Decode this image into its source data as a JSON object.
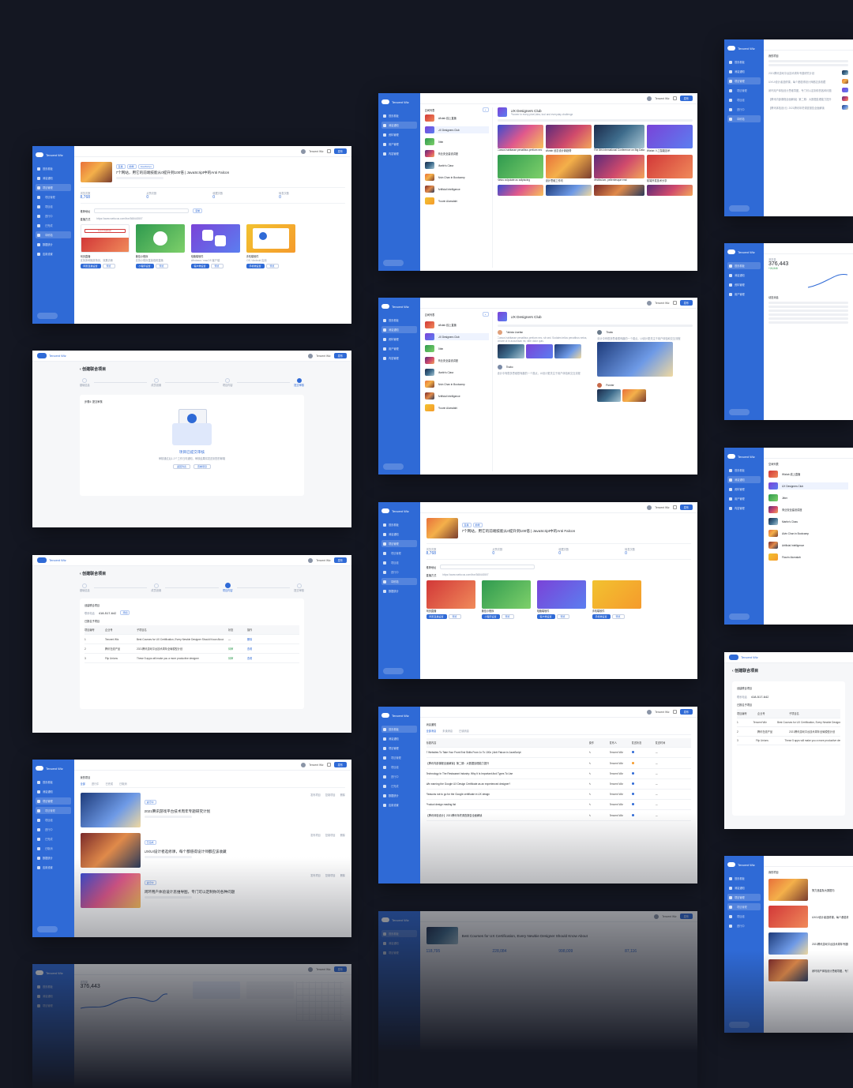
{
  "brand": {
    "name": "Tencent Wiz",
    "user": "Tencent Wiz",
    "publish": "发布"
  },
  "nav": [
    "首页看板",
    "消息通知",
    "资料管理",
    "项目管理",
    "用户管理",
    "数据统计",
    "内容管理",
    "应用设置"
  ],
  "nav_sub": [
    "项目管理",
    "项目组",
    "进行中",
    "已完成",
    "已取消",
    "草稿箱"
  ],
  "s1": {
    "title": "7个网站，用它的前端技能从0提升到100倍 | JavaScript中的Anti Falcon",
    "stats": [
      {
        "label": "浏览次数",
        "value": "8,768"
      },
      {
        "label": "点赞次数",
        "value": "0"
      },
      {
        "label": "收藏次数",
        "value": "0"
      },
      {
        "label": "转发次数",
        "value": "0"
      }
    ],
    "link_label": "推荐地址",
    "link_url": "https://www.wefocus.com/live/368443507",
    "share_label": "直播方式",
    "cards": [
      {
        "name": "网页直播",
        "desc": "支持多种播放场景，效果清晰",
        "primary": "网页直播设置",
        "secondary": "预览"
      },
      {
        "name": "微信小程序",
        "desc": "支持小程序直接观看直播",
        "primary": "小程序设置",
        "secondary": "预览"
      },
      {
        "name": "电脑端软件",
        "desc": "Windows / macOS 客户端",
        "primary": "客户端设置",
        "secondary": "预览"
      },
      {
        "name": "手机端软件",
        "desc": "iOS / Android 应用",
        "primary": "手机端设置",
        "secondary": "预览"
      }
    ],
    "badge": "Live broadcast"
  },
  "s2": {
    "back": "创建联合项目",
    "steps": [
      "基础信息",
      "成员设置",
      "项目内容",
      "提交审核"
    ],
    "section": "步骤4: 提交审核",
    "done_title": "项目已提交审核",
    "done_desc": "审核通过后1-2个工作日内通知，审核结果将发送到您的邮箱",
    "btn1": "返回列表",
    "btn2": "查看项目"
  },
  "s3": {
    "back": "创建联合项目",
    "steps": [
      "基础信息",
      "成员设置",
      "项目内容",
      "提交审核"
    ],
    "section": "创建联合项目",
    "phone_label": "联系电话",
    "phone": "418-517-642",
    "add": "添加",
    "table_title": "已报名子项目",
    "cols": [
      "项目编号",
      "企业号",
      "子项目名",
      "状态",
      "操作"
    ],
    "rows": [
      {
        "id": "1",
        "org": "Tencent Wiz",
        "name": "Best Courses for UX Certification, Every Newbie Designer Should Know About",
        "state": "—",
        "op": "删除"
      },
      {
        "id": "2",
        "org": "腾讯在线产品",
        "name": "2021腾讯游戏平台技术周年全局模型计划",
        "state": "待审",
        "op": "查看"
      },
      {
        "id": "3",
        "org": "Flip Unions",
        "name": "These 5 apps will make you a more productive designer",
        "state": "待审",
        "op": "查看"
      }
    ]
  },
  "s4": {
    "title": "我的项目",
    "tabs": [
      "全部",
      "进行中",
      "已完成",
      "已取消"
    ],
    "items": [
      {
        "title": "2021腾讯游戏平台技术周年专题研究计划",
        "tag": "进行中"
      },
      {
        "title": "UX/UI设计者选修课，每个都值得设计师都应该收藏",
        "tag": "已完成"
      },
      {
        "title": "闭环用户体验设计思维导图，专门可以定制你的各种问题",
        "tag": "进行中"
      }
    ],
    "actions": [
      "发布项目",
      "复制项目",
      "删除"
    ]
  },
  "s5": {
    "title": "浏览量",
    "value": "376,443"
  },
  "r1": {
    "list_title": "空间列表",
    "spaces": [
      "Wizlab 线上直播",
      "UX Designers Club",
      "Jitter",
      "商业安全建设讲座",
      "Martin's Class",
      "Alvin Chan in Bootcamp",
      "Artificial Intelligence",
      "Flourin Alumalahi"
    ],
    "club": "UX Designers Club",
    "club_desc": "Pioneer in every pixel,idea, tool and everyday challenge",
    "captions": [
      "Cursus habitasse penatibus pretium nec",
      "Wizlab 创意设计新趋势",
      "The 8th International Conference on Big Data",
      "Wizlab 人工智能技术",
      "Netus vulputate ac adipiscing",
      "设计思维工作坊",
      "Vestibulum, pellentesque erat",
      "前端开发技术分享"
    ]
  },
  "r2": {
    "club": "UX Designers Club",
    "authors": [
      "Fabiola Lisefan",
      "Thabo",
      "Thabo",
      "Pomter"
    ],
    "post1": "Cursus habitasse penatibus pretium nec, sit sed. Sodales tellus penatibus netus, ornare ut in accumsan mi, nibh dolor quis.",
    "post2": "设计中有很多思维很有趣的一个观点，UI设计更关注于用户体验和交互流程"
  },
  "r3": {
    "title": "7个网站，用它的前端技能从0提升到100倍 | JavaScript中的Anti Falcon",
    "views": "8,768",
    "zero": "0"
  },
  "r4": {
    "title": "消息通知",
    "tabs": [
      "全部消息",
      "未读消息",
      "已读消息"
    ],
    "cols": [
      "标题内容",
      "操作",
      "发布人",
      "发送状态",
      "发送时间"
    ],
    "rows": [
      "7 Websites To Take Your Front End Skills From 1x To 100x | Anti Falcon in JavaScript",
      "【腾讯内部课程全面解读】第二期：大数据处理能力提升",
      "Technology In The Restaurant Industry: Why It Is Important And Types To Use",
      "Win earning the Google UX Design Certificate as an experienced designer?",
      "Reasons not to go for the Google certificate in UX design",
      "Product design reading list",
      "【腾讯体验设计】2021腾讯年终调查报告全面解读"
    ]
  },
  "r5": {
    "title": "Best Courses for UX Certification, Every Newbie Designer Should Know About",
    "stats": [
      "118,795",
      "228,084",
      "998,009",
      "87,116"
    ]
  },
  "f1": {
    "title": "我的项目"
  },
  "f2": {
    "title": "浏览量",
    "value": "376,443",
    "growth": "+24,846",
    "sub": "动态消息"
  },
  "f3": {
    "title": "空间列表"
  },
  "f4": {
    "back": "创建联合项目",
    "phone": "418-517-642"
  },
  "f5": {
    "title": "我的项目",
    "item": "努力造星际大数据与"
  }
}
